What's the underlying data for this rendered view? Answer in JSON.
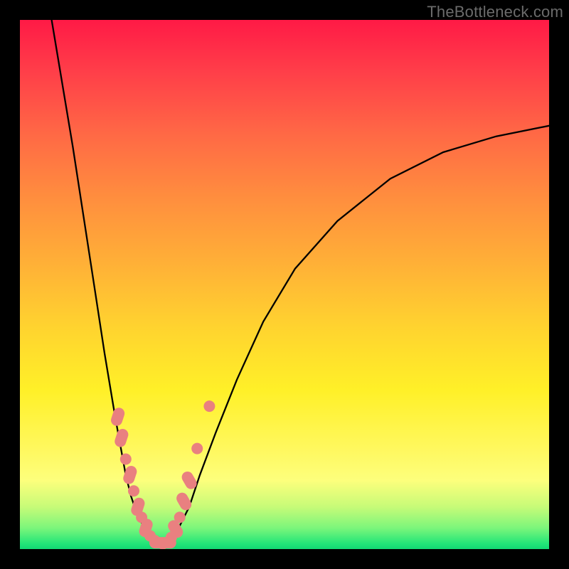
{
  "watermark": "TheBottleneck.com",
  "colors": {
    "frame": "#000000",
    "gradient_top": "#ff1a46",
    "gradient_bottom": "#12d873",
    "bead": "#e98080",
    "curve": "#000000"
  },
  "chart_data": {
    "type": "line",
    "title": "",
    "xlabel": "",
    "ylabel": "",
    "xlim": [
      0,
      100
    ],
    "ylim": [
      0,
      100
    ],
    "grid": false,
    "series": [
      {
        "name": "left-curve",
        "x": [
          6,
          8,
          10,
          12,
          14,
          16,
          18,
          20,
          21,
          22,
          23,
          24,
          25,
          26,
          27
        ],
        "y": [
          100,
          88,
          76,
          63,
          50,
          37,
          25,
          14,
          10,
          7,
          5,
          3,
          2,
          1.3,
          1
        ]
      },
      {
        "name": "right-curve",
        "x": [
          27,
          28,
          30,
          32,
          34,
          37,
          41,
          46,
          52,
          60,
          70,
          80,
          90,
          100
        ],
        "y": [
          1,
          1.5,
          4,
          8,
          14,
          22,
          32,
          43,
          53,
          62,
          70,
          75,
          78,
          80
        ]
      }
    ],
    "annotations": {
      "bead_markers_left": [
        {
          "x": 18.5,
          "y": 25,
          "shape": "pill"
        },
        {
          "x": 19.2,
          "y": 21,
          "shape": "pill"
        },
        {
          "x": 20.0,
          "y": 17,
          "shape": "dot"
        },
        {
          "x": 20.8,
          "y": 14,
          "shape": "pill"
        },
        {
          "x": 21.5,
          "y": 11,
          "shape": "dot"
        },
        {
          "x": 22.3,
          "y": 8,
          "shape": "pill"
        },
        {
          "x": 23.0,
          "y": 6,
          "shape": "dot"
        },
        {
          "x": 23.8,
          "y": 4,
          "shape": "pill"
        },
        {
          "x": 24.6,
          "y": 2.5,
          "shape": "dot"
        },
        {
          "x": 25.5,
          "y": 1.6,
          "shape": "dot"
        }
      ],
      "bead_markers_bottom": [
        {
          "x": 26.2,
          "y": 1.2,
          "shape": "pill"
        },
        {
          "x": 27.0,
          "y": 1.0,
          "shape": "dot"
        },
        {
          "x": 27.8,
          "y": 1.2,
          "shape": "pill"
        }
      ],
      "bead_markers_right": [
        {
          "x": 28.6,
          "y": 2.2,
          "shape": "dot"
        },
        {
          "x": 29.4,
          "y": 3.8,
          "shape": "pill"
        },
        {
          "x": 30.2,
          "y": 6,
          "shape": "dot"
        },
        {
          "x": 31.0,
          "y": 9,
          "shape": "pill"
        },
        {
          "x": 32.0,
          "y": 13,
          "shape": "pill"
        },
        {
          "x": 33.5,
          "y": 19,
          "shape": "dot"
        },
        {
          "x": 35.8,
          "y": 27,
          "shape": "dot"
        }
      ]
    }
  }
}
